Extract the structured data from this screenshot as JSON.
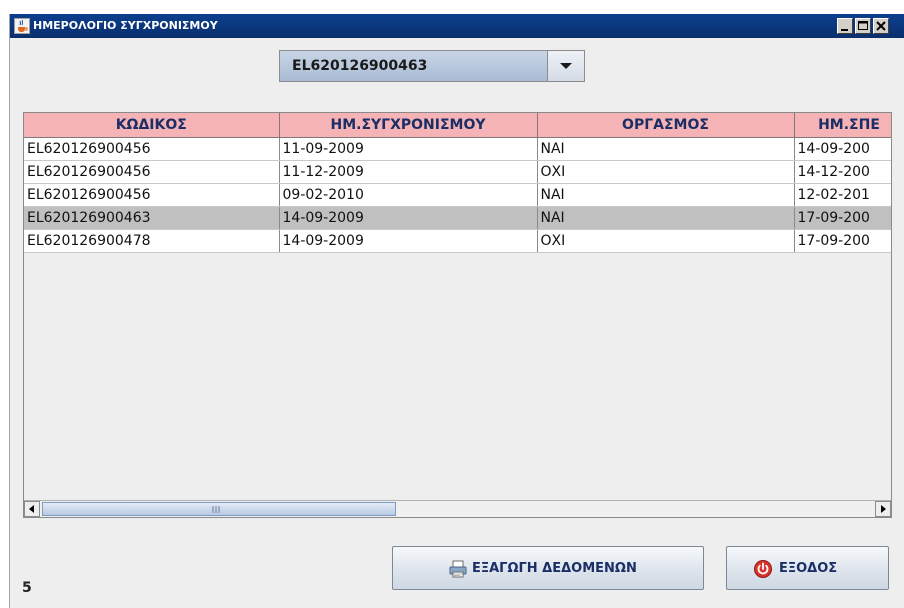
{
  "window": {
    "title": "ΗΜΕΡΟΛΟΓΙΟ ΣΥΓΧΡΟΝΙΣΜΟΥ",
    "icon": "java-cup-icon",
    "controls": [
      "minimize-icon",
      "maximize-icon",
      "close-icon"
    ]
  },
  "selector": {
    "value": "EL620126900463",
    "arrow_icon": "chevron-down-icon"
  },
  "table": {
    "columns": [
      "ΚΩΔΙΚΟΣ",
      "ΗΜ.ΣΥΓΧΡΟΝΙΣΜΟΥ",
      "ΟΡΓΑΣΜΟΣ",
      "ΗΜ.ΣΠΕ"
    ],
    "rows": [
      [
        "EL620126900456",
        "11-09-2009",
        "ΝΑΙ",
        "14-09-200"
      ],
      [
        "EL620126900456",
        "11-12-2009",
        "ΟΧΙ",
        "14-12-200"
      ],
      [
        "EL620126900456",
        "09-02-2010",
        "ΝΑΙ",
        "12-02-201"
      ],
      [
        "EL620126900463",
        "14-09-2009",
        "ΝΑΙ",
        "17-09-200"
      ],
      [
        "EL620126900478",
        "14-09-2009",
        "ΟΧΙ",
        "17-09-200"
      ]
    ],
    "selected_row_index": 3,
    "header_color": "#f5b3b6",
    "selected_color": "#c0c0c0"
  },
  "footer": {
    "record_count": "5",
    "export_button": {
      "label": "ΕΞΑΓΩΓΗ ΔΕΔΟΜΕΝΩΝ",
      "icon": "printer-icon"
    },
    "exit_button": {
      "label": "ΕΞΟΔΟΣ",
      "icon": "exit-power-icon"
    }
  },
  "colors": {
    "titlebar": "#0a2f6c",
    "combo": "#b9c9dd",
    "button_text": "#1b2f66"
  }
}
